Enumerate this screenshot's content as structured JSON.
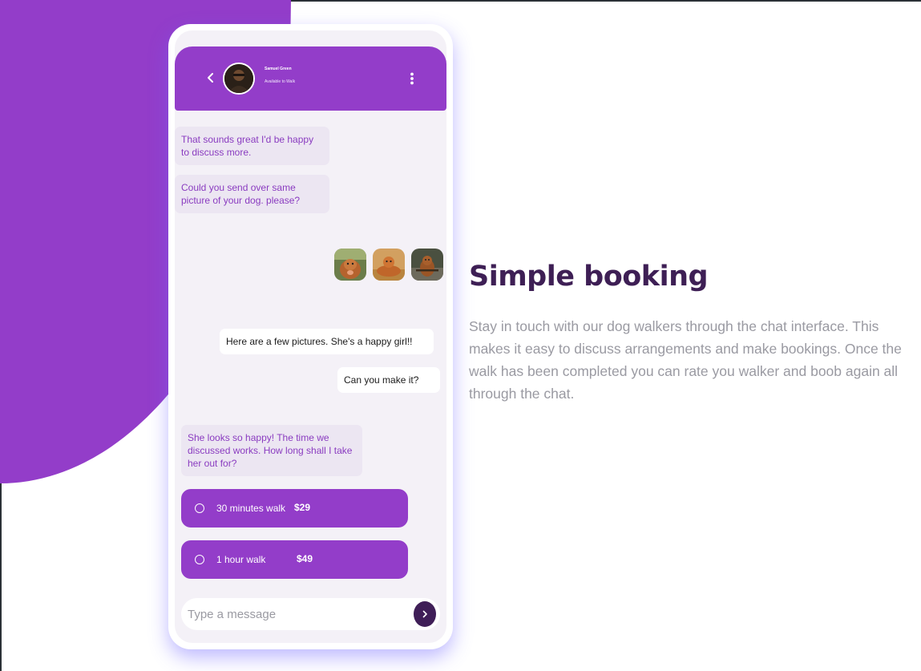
{
  "colors": {
    "brand_purple": "#933dc9",
    "dark_purple": "#3e1f55",
    "send_button": "#3f1e57",
    "screen_bg": "#f4f1f7",
    "incoming_bubble": "#ece6f2",
    "muted_text": "#9a9aa2"
  },
  "chat": {
    "header": {
      "back_icon": "chevron-left-icon",
      "contact_name": "Samuel Green",
      "contact_status": "Available to Walk",
      "menu_icon": "vertical-dots-icon"
    },
    "messages": [
      {
        "direction": "incoming",
        "text": "That sounds great I'd be happy\nto discuss more."
      },
      {
        "direction": "incoming",
        "text": "Could you send over same\npicture of your dog. please?"
      },
      {
        "direction": "outgoing",
        "text": "Here are a few pictures. She's a happy girl!!"
      },
      {
        "direction": "outgoing",
        "text": "Can you make it?"
      },
      {
        "direction": "incoming",
        "text": "She looks so happy! The time we\ndiscussed works. How long shall I take\nher out for?"
      }
    ],
    "photos": [
      "dog-photo-1",
      "dog-photo-2",
      "dog-photo-3"
    ],
    "options": [
      {
        "label": "30 minutes walk",
        "price": "$29",
        "selected": false
      },
      {
        "label": "1 hour walk",
        "price": "$49",
        "selected": false
      }
    ],
    "composer": {
      "placeholder": "Type a message",
      "value": "",
      "send_icon": "chevron-right-icon"
    }
  },
  "feature": {
    "title": "Simple booking",
    "description": "Stay in touch with our dog walkers through the chat interface. This makes it easy to discuss arrangements and make bookings. Once the walk has been completed you can rate you walker and boob again all through the chat."
  }
}
